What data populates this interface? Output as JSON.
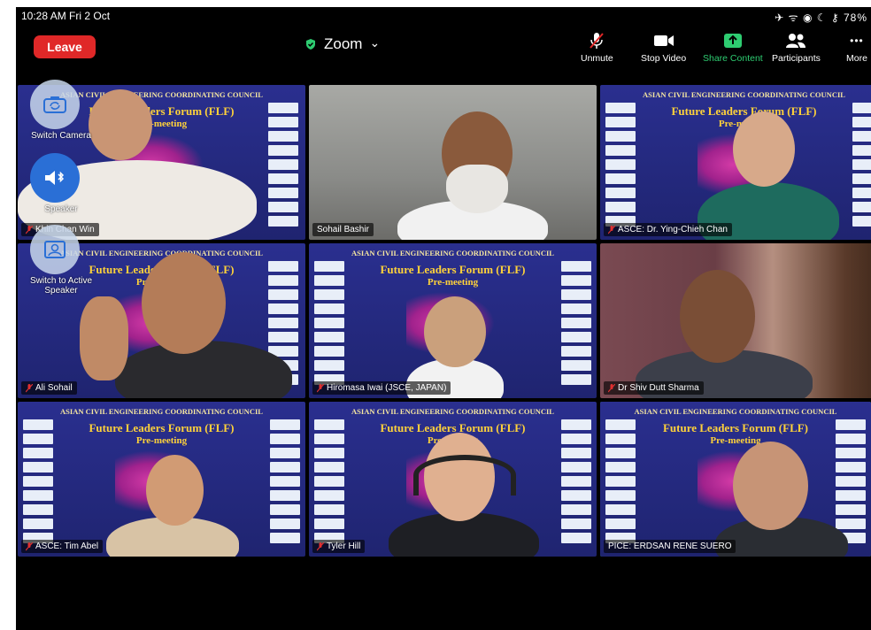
{
  "status_bar": {
    "time": "10:28 AM  Fri 2 Oct",
    "right": "✈ ᯤ ◉ ☾ ⚷ 78%"
  },
  "app": {
    "title": "Zoom",
    "title_caret": "⌄"
  },
  "toolbar": {
    "leave_label": "Leave",
    "unmute_label": "Unmute",
    "stop_video_label": "Stop Video",
    "share_label": "Share Content",
    "participants_label": "Participants",
    "more_label": "More",
    "more_glyph": "•••"
  },
  "floating": {
    "switch_camera_label": "Switch Camera",
    "speaker_label": "Speaker",
    "switch_view_label": "Switch to Active Speaker"
  },
  "slide": {
    "header": "ASIAN CIVIL ENGINEERING COORDINATING COUNCIL",
    "title": "Future Leaders Forum (FLF)",
    "subtitle": "Pre-meeting"
  },
  "participants": [
    {
      "name": "Khin Chan Win"
    },
    {
      "name": "Sohail Bashir"
    },
    {
      "name": "ASCE: Dr. Ying-Chieh Chan"
    },
    {
      "name": "Ali Sohail"
    },
    {
      "name": "Hiromasa Iwai (JSCE, JAPAN)"
    },
    {
      "name": "Dr Shiv Dutt Sharma"
    },
    {
      "name": "ASCE: Tim Abel"
    },
    {
      "name": "Tyler Hill"
    },
    {
      "name": "PICE: ERDSAN RENE SUERO"
    }
  ],
  "colors": {
    "leave": "#e02828",
    "accent_green": "#2ecc71",
    "active_border": "#29c35c"
  }
}
